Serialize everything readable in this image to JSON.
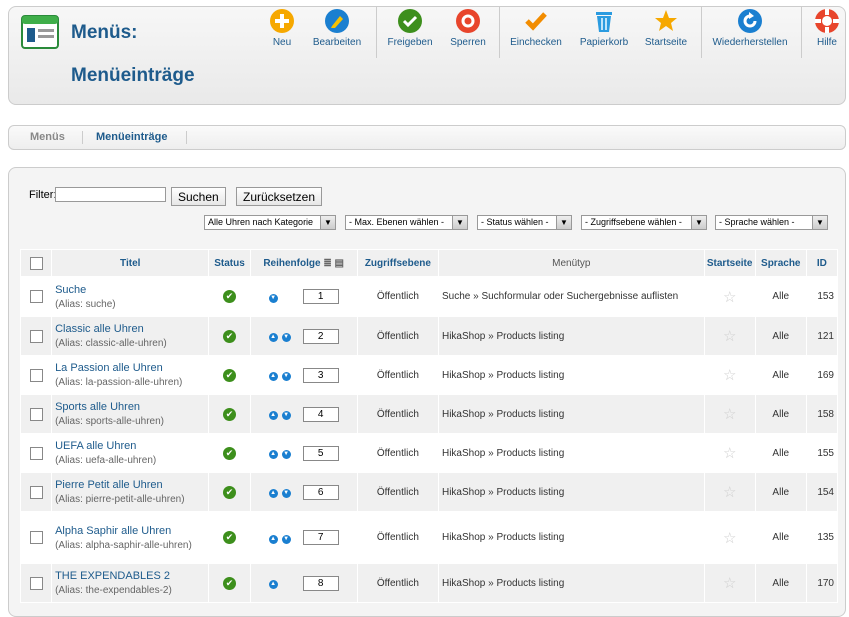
{
  "header": {
    "title": "Menüs:",
    "subtitle": "Menüeinträge"
  },
  "toolbar": {
    "buttons": [
      {
        "label": "Neu",
        "icon": "plus-icon",
        "color": "#f6a800"
      },
      {
        "label": "Bearbeiten",
        "icon": "pencil-icon",
        "color": "#1a7fd0"
      },
      {
        "label": "Freigeben",
        "icon": "checkmark-icon",
        "color": "#3d8f1c"
      },
      {
        "label": "Sperren",
        "icon": "stop-icon",
        "color": "#e8452c"
      },
      {
        "label": "Einchecken",
        "icon": "checkin-icon",
        "color": "#f28c00"
      },
      {
        "label": "Papierkorb",
        "icon": "trash-icon",
        "color": "#2a9be0"
      },
      {
        "label": "Startseite",
        "icon": "star-icon",
        "color": "#f6a800"
      },
      {
        "label": "Wiederherstellen",
        "icon": "refresh-icon",
        "color": "#1a7fd0"
      },
      {
        "label": "Hilfe",
        "icon": "lifebuoy-icon",
        "color": "#e8452c"
      }
    ]
  },
  "submenu": {
    "items": [
      {
        "label": "Menüs",
        "active": false
      },
      {
        "label": "Menüeinträge",
        "active": true
      }
    ]
  },
  "filter": {
    "label": "Filter:",
    "value": "",
    "search_button": "Suchen",
    "reset_button": "Zurücksetzen"
  },
  "selects": [
    "Alle Uhren nach Kategorie",
    "- Max. Ebenen wählen -",
    "- Status wählen -",
    "- Zugriffsebene wählen -",
    "- Sprache wählen -"
  ],
  "table": {
    "headers": {
      "title": "Titel",
      "status": "Status",
      "ordering": "Reihenfolge",
      "access": "Zugriffsebene",
      "menutype": "Menütyp",
      "home": "Startseite",
      "language": "Sprache",
      "id": "ID"
    },
    "rows": [
      {
        "title": "Suche",
        "alias": "(Alias: suche)",
        "order": "1",
        "up": false,
        "down": true,
        "access": "Öffentlich",
        "type": "Suche » Suchformular oder Suchergebnisse auflisten",
        "language": "Alle",
        "id": "153"
      },
      {
        "title": "Classic alle Uhren",
        "alias": "(Alias: classic-alle-uhren)",
        "order": "2",
        "up": true,
        "down": true,
        "access": "Öffentlich",
        "type": "HikaShop » Products listing",
        "language": "Alle",
        "id": "121"
      },
      {
        "title": "La Passion alle Uhren",
        "alias": "(Alias: la-passion-alle-uhren)",
        "order": "3",
        "up": true,
        "down": true,
        "access": "Öffentlich",
        "type": "HikaShop » Products listing",
        "language": "Alle",
        "id": "169"
      },
      {
        "title": "Sports alle Uhren",
        "alias": "(Alias: sports-alle-uhren)",
        "order": "4",
        "up": true,
        "down": true,
        "access": "Öffentlich",
        "type": "HikaShop » Products listing",
        "language": "Alle",
        "id": "158"
      },
      {
        "title": "UEFA alle Uhren",
        "alias": "(Alias: uefa-alle-uhren)",
        "order": "5",
        "up": true,
        "down": true,
        "access": "Öffentlich",
        "type": "HikaShop » Products listing",
        "language": "Alle",
        "id": "155"
      },
      {
        "title": "Pierre Petit alle Uhren",
        "alias": "(Alias: pierre-petit-alle-uhren)",
        "order": "6",
        "up": true,
        "down": true,
        "access": "Öffentlich",
        "type": "HikaShop » Products listing",
        "language": "Alle",
        "id": "154"
      },
      {
        "title": "Alpha Saphir alle Uhren",
        "alias": "(Alias: alpha-saphir-alle-uhren)",
        "order": "7",
        "up": true,
        "down": true,
        "access": "Öffentlich",
        "type": "HikaShop » Products listing",
        "language": "Alle",
        "id": "135"
      },
      {
        "title": "THE EXPENDABLES 2",
        "alias": "(Alias: the-expendables-2)",
        "order": "8",
        "up": true,
        "down": false,
        "access": "Öffentlich",
        "type": "HikaShop » Products listing",
        "language": "Alle",
        "id": "170"
      }
    ]
  }
}
